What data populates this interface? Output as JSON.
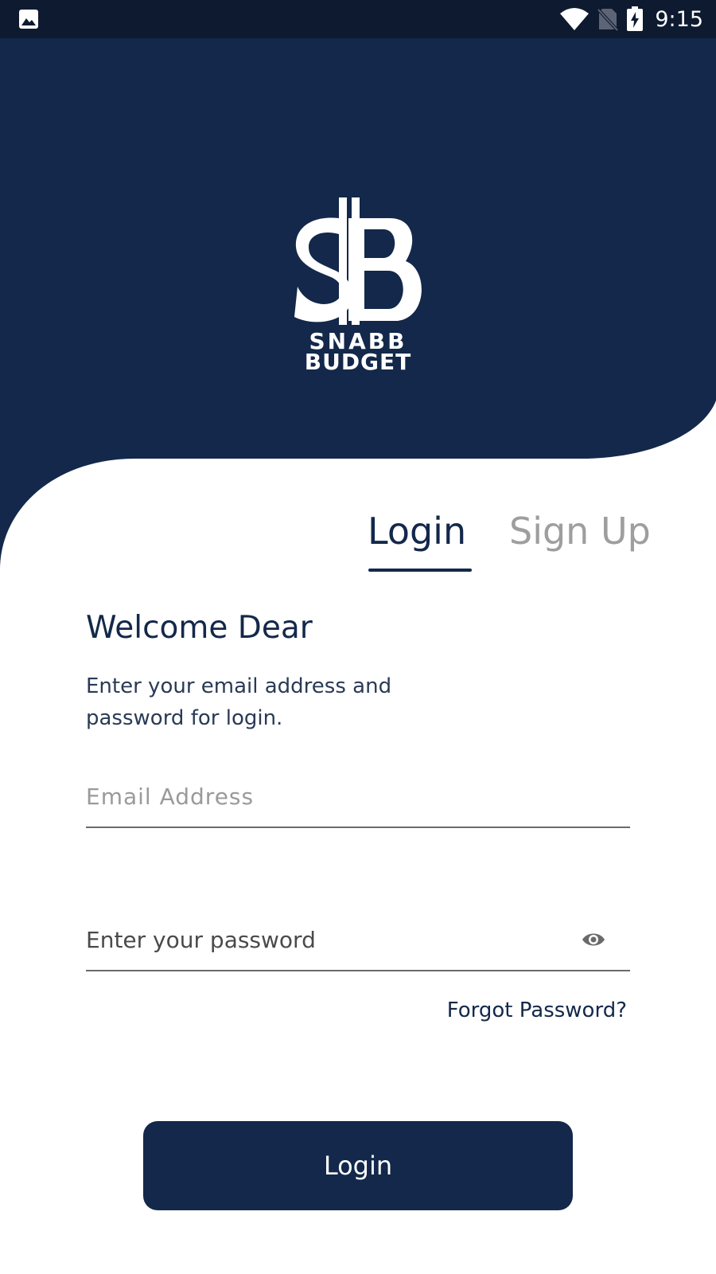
{
  "status_bar": {
    "time": "9:15",
    "icons": [
      "image-icon",
      "wifi-icon",
      "no-sim-icon",
      "battery-charging-icon"
    ]
  },
  "brand": {
    "name_line1": "SNABB",
    "name_line2": "BUDGET",
    "colors": {
      "primary": "#13284a",
      "status_bar": "#0e1a30",
      "inactive_tab": "#9e9e9e"
    }
  },
  "tabs": [
    {
      "label": "Login",
      "active": true
    },
    {
      "label": "Sign Up",
      "active": false
    }
  ],
  "form": {
    "welcome": "Welcome Dear",
    "subtitle": "Enter your email address and password for login.",
    "email": {
      "placeholder": "Email Address",
      "value": ""
    },
    "password": {
      "placeholder": "Enter your password",
      "value": "",
      "toggle_icon": "eye-icon"
    },
    "forgot_label": "Forgot Password?",
    "submit_label": "Login"
  }
}
